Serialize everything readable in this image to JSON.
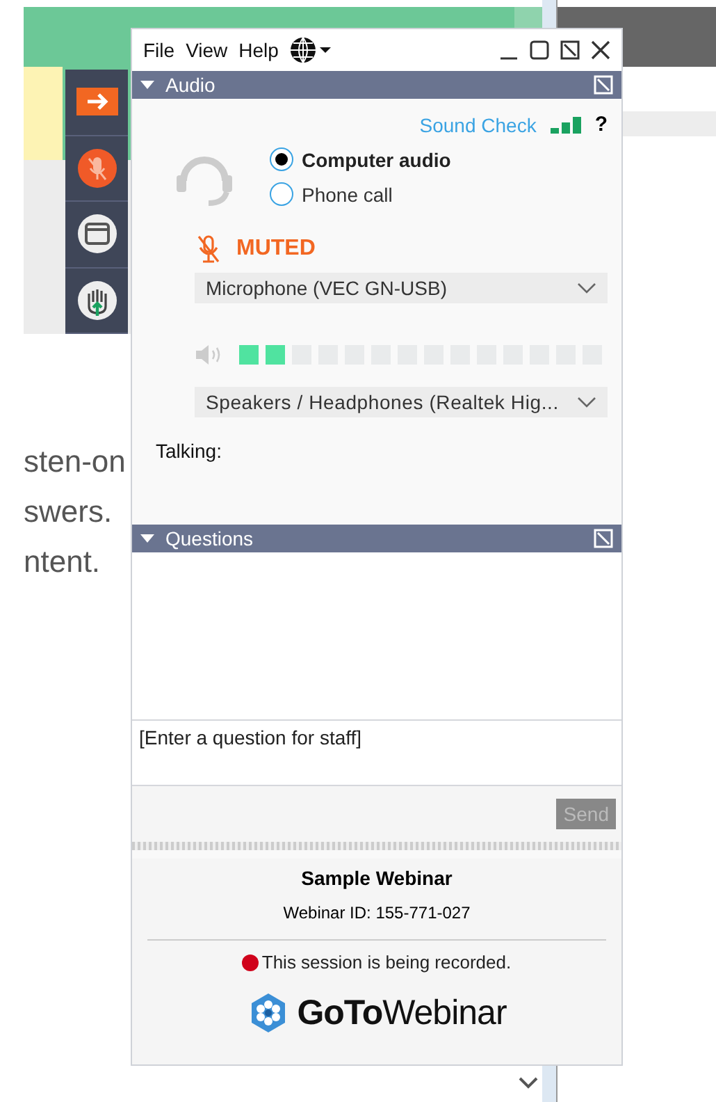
{
  "background_text": [
    "sten-on",
    "swers.",
    "ntent."
  ],
  "menu": [
    "File",
    "View",
    "Help"
  ],
  "audio": {
    "title": "Audio",
    "sound_check": "Sound Check",
    "help": "?",
    "options": [
      {
        "label": "Computer audio",
        "selected": true
      },
      {
        "label": "Phone call",
        "selected": false
      }
    ],
    "muted": true,
    "mic_status": "MUTED",
    "microphone": "Microphone (VEC GN-USB)",
    "speaker_meter": {
      "level": 0.143
    },
    "speakers": "Speakers / Headphones (Realtek Hig...",
    "talking_label": "Talking:"
  },
  "questions": {
    "title": "Questions",
    "placeholder": "[Enter a question for staff]",
    "send": "Send",
    "send_disabled": true
  },
  "footer": {
    "webinar_name": "Sample Webinar",
    "webinar_id": "Webinar ID: 155-771-027",
    "recording": "This session is being recorded.",
    "logo": "**GoTo**Webinar"
  }
}
